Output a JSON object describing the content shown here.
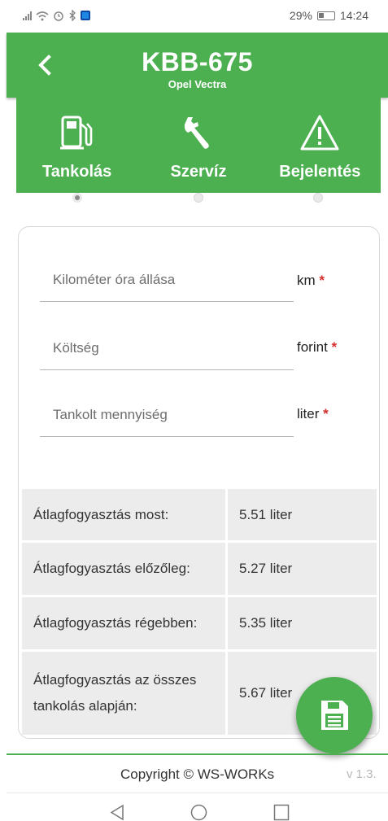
{
  "status_bar": {
    "battery": "29%",
    "time": "14:24"
  },
  "header": {
    "plate": "KBB-675",
    "car_model": "Opel Vectra"
  },
  "tabs": [
    {
      "label": "Tankolás",
      "icon": "fuel-pump-icon",
      "active": true
    },
    {
      "label": "Szervíz",
      "icon": "wrench-icon",
      "active": false
    },
    {
      "label": "Bejelentés",
      "icon": "warning-icon",
      "active": false
    }
  ],
  "form": {
    "odometer": {
      "placeholder": "Kilométer óra állása",
      "value": "",
      "unit": "km",
      "required_mark": "*"
    },
    "cost": {
      "placeholder": "Költség",
      "value": "",
      "unit": "forint",
      "required_mark": "*"
    },
    "quantity": {
      "placeholder": "Tankolt mennyiség",
      "value": "",
      "unit": "liter",
      "required_mark": "*"
    }
  },
  "stats": [
    {
      "label": "Átlagfogyasztás most:",
      "value": "5.51 liter"
    },
    {
      "label": "Átlagfogyasztás előzőleg:",
      "value": "5.27 liter"
    },
    {
      "label": "Átlagfogyasztás régebben:",
      "value": "5.35 liter"
    },
    {
      "label": "Átlagfogyasztás az összes tankolás alapján:",
      "value": "5.67 liter"
    }
  ],
  "save_button_icon": "floppy-save-icon",
  "footer": {
    "copyright": "Copyright © WS-WORKs",
    "version": "v 1.3."
  },
  "colors": {
    "primary": "#4caf50",
    "required": "#d32f2f",
    "stat_bg": "#ececec"
  }
}
